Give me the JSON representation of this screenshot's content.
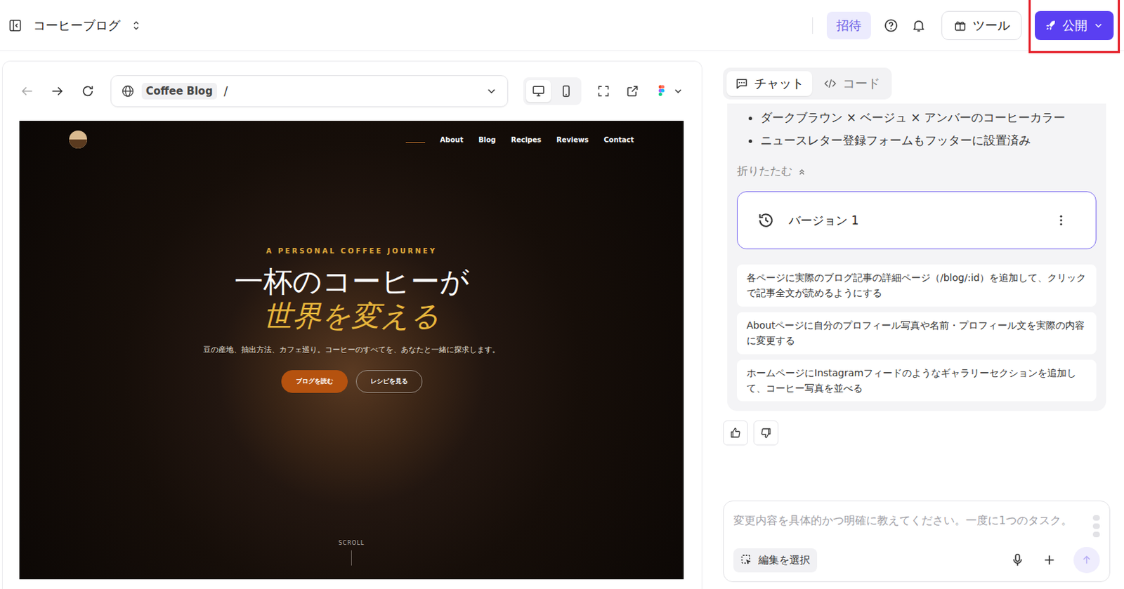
{
  "window": {
    "title": "コーヒーブログ"
  },
  "header": {
    "invite": "招待",
    "tools": "ツール",
    "publish": "公開",
    "publish_highlighted": true
  },
  "preview": {
    "url_chip": "Coffee Blog",
    "path": "/",
    "devices": [
      {
        "name": "desktop",
        "selected": true
      },
      {
        "name": "mobile",
        "selected": false
      }
    ]
  },
  "site": {
    "nav": [
      {
        "label": "",
        "selected": true
      },
      {
        "label": "About",
        "selected": false
      },
      {
        "label": "Blog",
        "selected": false
      },
      {
        "label": "Recipes",
        "selected": false
      },
      {
        "label": "Reviews",
        "selected": false
      },
      {
        "label": "Contact",
        "selected": false
      }
    ],
    "eyebrow": "A PERSONAL COFFEE JOURNEY",
    "title_line1": "一杯のコーヒーが",
    "title_line2": "世界を変える",
    "subtitle": "豆の産地、抽出方法、カフェ巡り。コーヒーのすべてを、あなたと一緒に探求します。",
    "buttons": [
      {
        "label": "ブログを読む",
        "kind": "primary"
      },
      {
        "label": "レシピを見る",
        "kind": "outline"
      }
    ],
    "scroll": "SCROLL"
  },
  "chat_tabs": [
    {
      "label": "チャット",
      "selected": true
    },
    {
      "label": "コード",
      "selected": false
    }
  ],
  "message": {
    "bullets": [
      "ダークブラウン × ベージュ × アンバーのコーヒーカラー",
      "ニュースレター登録フォームもフッターに設置済み"
    ],
    "collapse": "折りたたむ"
  },
  "version": {
    "label": "バージョン 1"
  },
  "suggestions": [
    "各ページに実際のブログ記事の詳細ページ（/blog/:id）を追加して、クリックで記事全文が読めるようにする",
    "Aboutページに自分のプロフィール写真や名前・プロフィール文を実際の内容に変更する",
    "ホームページにInstagramフィードのようなギャラリーセクションを追加して、コーヒー写真を並べる"
  ],
  "composer": {
    "placeholder": "変更内容を具体的かつ明確に教えてください。一度に1つのタスク。",
    "select_edit": "編集を選択"
  }
}
